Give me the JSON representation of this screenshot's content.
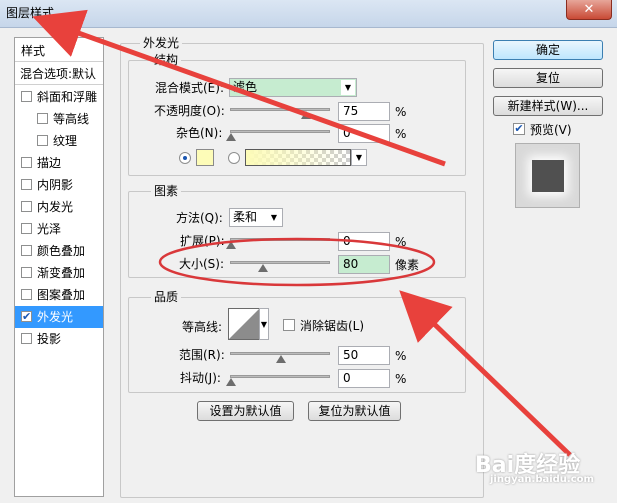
{
  "window": {
    "title": "图层样式",
    "close_glyph": "✕"
  },
  "left_panel": {
    "header": "样式",
    "blend_options": "混合选项:默认",
    "items": [
      {
        "label": "斜面和浮雕",
        "checked": false,
        "indent": false
      },
      {
        "label": "等高线",
        "checked": false,
        "indent": true
      },
      {
        "label": "纹理",
        "checked": false,
        "indent": true
      },
      {
        "label": "描边",
        "checked": false,
        "indent": false
      },
      {
        "label": "内阴影",
        "checked": false,
        "indent": false
      },
      {
        "label": "内发光",
        "checked": false,
        "indent": false
      },
      {
        "label": "光泽",
        "checked": false,
        "indent": false
      },
      {
        "label": "颜色叠加",
        "checked": false,
        "indent": false
      },
      {
        "label": "渐变叠加",
        "checked": false,
        "indent": false
      },
      {
        "label": "图案叠加",
        "checked": false,
        "indent": false
      },
      {
        "label": "外发光",
        "checked": true,
        "indent": false,
        "selected": true
      },
      {
        "label": "投影",
        "checked": false,
        "indent": false
      }
    ]
  },
  "outer_glow": {
    "title": "外发光",
    "structure": {
      "title": "结构",
      "blend_mode_label": "混合模式(E):",
      "blend_mode_value": "滤色",
      "opacity_label": "不透明度(O):",
      "opacity_value": "75",
      "opacity_unit": "%",
      "opacity_level": 0.75,
      "noise_label": "杂色(N):",
      "noise_value": "0",
      "noise_unit": "%",
      "noise_level": 0,
      "glow_color": "#fdfcb8"
    },
    "elements": {
      "title": "图素",
      "technique_label": "方法(Q):",
      "technique_value": "柔和",
      "spread_label": "扩展(P):",
      "spread_value": "0",
      "spread_unit": "%",
      "spread_level": 0,
      "size_label": "大小(S):",
      "size_value": "80",
      "size_unit": "像素",
      "size_level": 0.32
    },
    "quality": {
      "title": "品质",
      "contour_label": "等高线:",
      "antialias_label": "消除锯齿(L)",
      "antialias_checked": false,
      "range_label": "范围(R):",
      "range_value": "50",
      "range_unit": "%",
      "range_level": 0.5,
      "jitter_label": "抖动(J):",
      "jitter_value": "0",
      "jitter_unit": "%",
      "jitter_level": 0
    },
    "make_default": "设置为默认值",
    "reset_default": "复位为默认值"
  },
  "right_panel": {
    "ok": "确定",
    "reset": "复位",
    "new_style": "新建样式(W)...",
    "preview_label": "预览(V)",
    "preview_checked": true
  },
  "watermark": {
    "text": "Bai度经验",
    "sub": "jingyan.baidu.com"
  },
  "colors": {
    "selection": "#3399ff",
    "highlight_ellipse": "#d9383a",
    "annotation_arrow": "#e8413c"
  }
}
